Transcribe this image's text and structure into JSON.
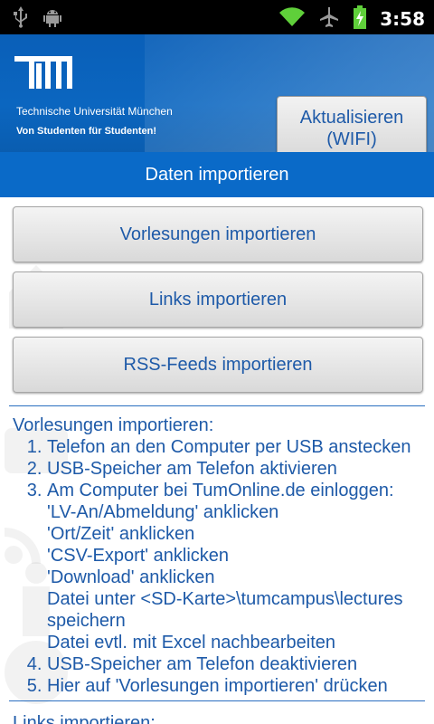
{
  "status_bar": {
    "time": "3:58",
    "icons": [
      "usb-icon",
      "android-debug-icon",
      "wifi-icon",
      "airplane-icon",
      "battery-charging-icon"
    ]
  },
  "header": {
    "logo": "TUM",
    "university": "Technische Universität München",
    "slogan": "Von Studenten für Studenten!",
    "refresh_button_line1": "Aktualisieren",
    "refresh_button_line2": "(WIFI)"
  },
  "title": "Daten importieren",
  "buttons": {
    "lectures": "Vorlesungen importieren",
    "links": "Links importieren",
    "rss": "RSS-Feeds importieren"
  },
  "instructions": {
    "heading": "Vorlesungen importieren:",
    "steps": [
      "Telefon an den Computer per USB anstecken",
      "USB-Speicher am Telefon aktivieren",
      "Am Computer bei TumOnline.de einloggen:",
      "USB-Speicher am Telefon deaktivieren",
      "Hier auf 'Vorlesungen importieren' drücken"
    ],
    "substeps": [
      "'LV-An/Abmeldung' anklicken",
      "'Ort/Zeit' anklicken",
      "'CSV-Export' anklicken",
      "'Download' anklicken",
      "Datei unter <SD-Karte>\\tumcampus\\lectures speichern",
      "Datei evtl. mit Excel nachbearbeiten"
    ],
    "next_heading": "Links importieren:"
  },
  "colors": {
    "accent": "#0a6ac8",
    "text_blue": "#1e5aa8",
    "status_bar": "#000000"
  }
}
